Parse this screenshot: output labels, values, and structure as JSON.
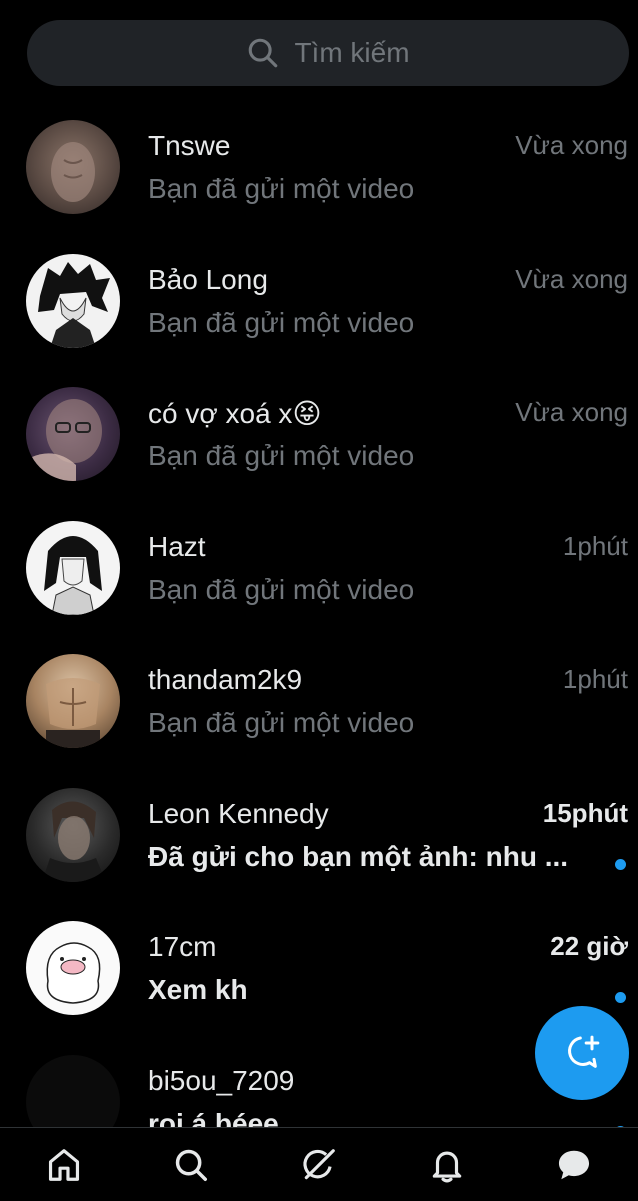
{
  "search": {
    "placeholder": "Tìm kiếm"
  },
  "conversations": [
    {
      "name": "Tnswe",
      "time": "Vừa xong",
      "preview": "Bạn đã gửi một video",
      "unread": false
    },
    {
      "name": "Bảo Long",
      "time": "Vừa xong",
      "preview": "Bạn đã gửi một video",
      "unread": false
    },
    {
      "name": "có vợ xoá x😝",
      "time": "Vừa xong",
      "preview": "Bạn đã gửi một video",
      "unread": false
    },
    {
      "name": "Hazt",
      "time": "1phút",
      "preview": "Bạn đã gửi một video",
      "unread": false
    },
    {
      "name": "thandam2k9",
      "time": "1phút",
      "preview": "Bạn đã gửi một video",
      "unread": false
    },
    {
      "name": "Leon Kennedy",
      "time": "15phút",
      "preview": "Đã gửi cho bạn một ảnh: nhu ...",
      "unread": true
    },
    {
      "name": "17cm",
      "time": "22 giờ",
      "preview": "Xem kh",
      "unread": true
    },
    {
      "name": "bi5ou_7209",
      "time": "",
      "preview": "roi á béee",
      "unread": true
    }
  ],
  "fab": {
    "icon": "new-message-icon"
  },
  "tabs": [
    {
      "icon": "home-icon"
    },
    {
      "icon": "search-icon"
    },
    {
      "icon": "grok-icon"
    },
    {
      "icon": "notifications-icon"
    },
    {
      "icon": "messages-icon"
    }
  ],
  "colors": {
    "accent": "#1d9bf0",
    "background": "#000000",
    "muted": "#71767b",
    "text": "#e7e9ea"
  }
}
